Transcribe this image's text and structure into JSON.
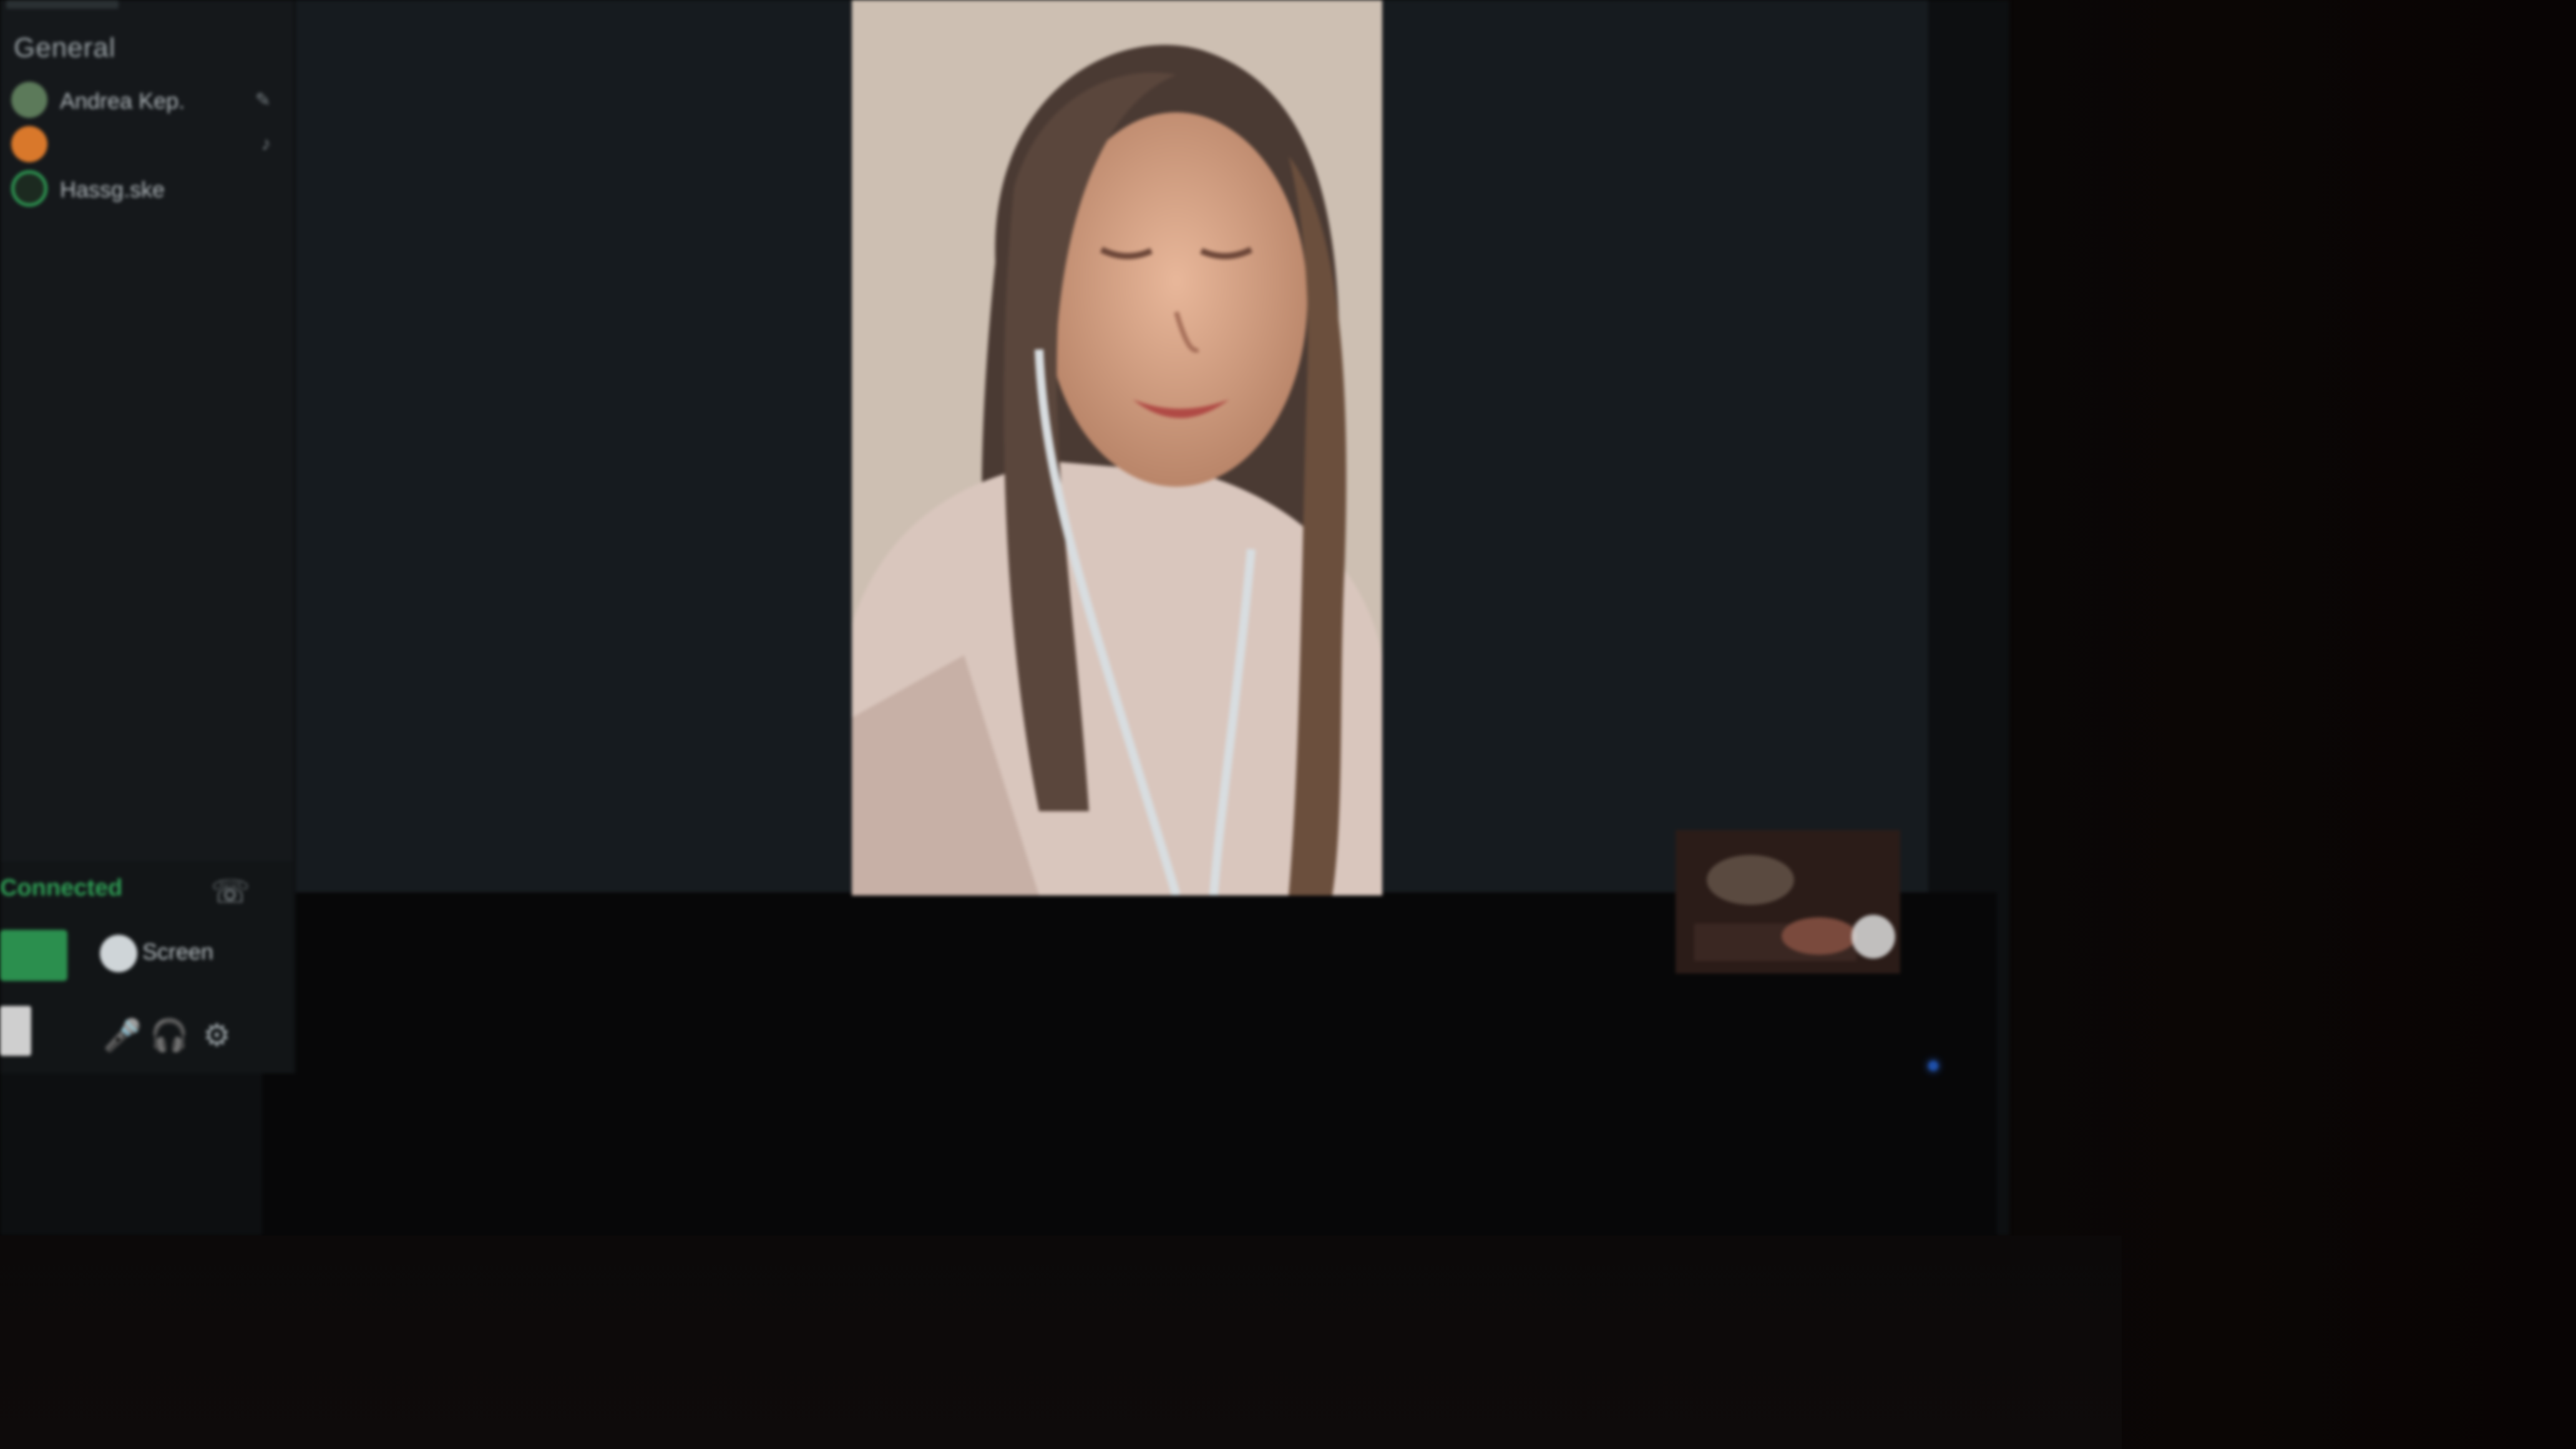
{
  "sidebar": {
    "server_name": "General",
    "members": [
      {
        "name": "Andrea Kep.",
        "avatar_color": "#5c7a5a",
        "icon": "mic-icon",
        "icon_glyph": "✎"
      },
      {
        "name": "",
        "avatar_color": "#d9782b",
        "icon": "volume-icon",
        "icon_glyph": "♪"
      },
      {
        "name": "Hassg.ske",
        "avatar_color": "#2f9e55",
        "icon": "",
        "icon_glyph": ""
      }
    ],
    "voice": {
      "status": "Connected",
      "channel": "",
      "video_label": "",
      "screen_label": "Screen"
    }
  },
  "call": {
    "remote_participant": "",
    "accent": "#2b8f4e"
  }
}
